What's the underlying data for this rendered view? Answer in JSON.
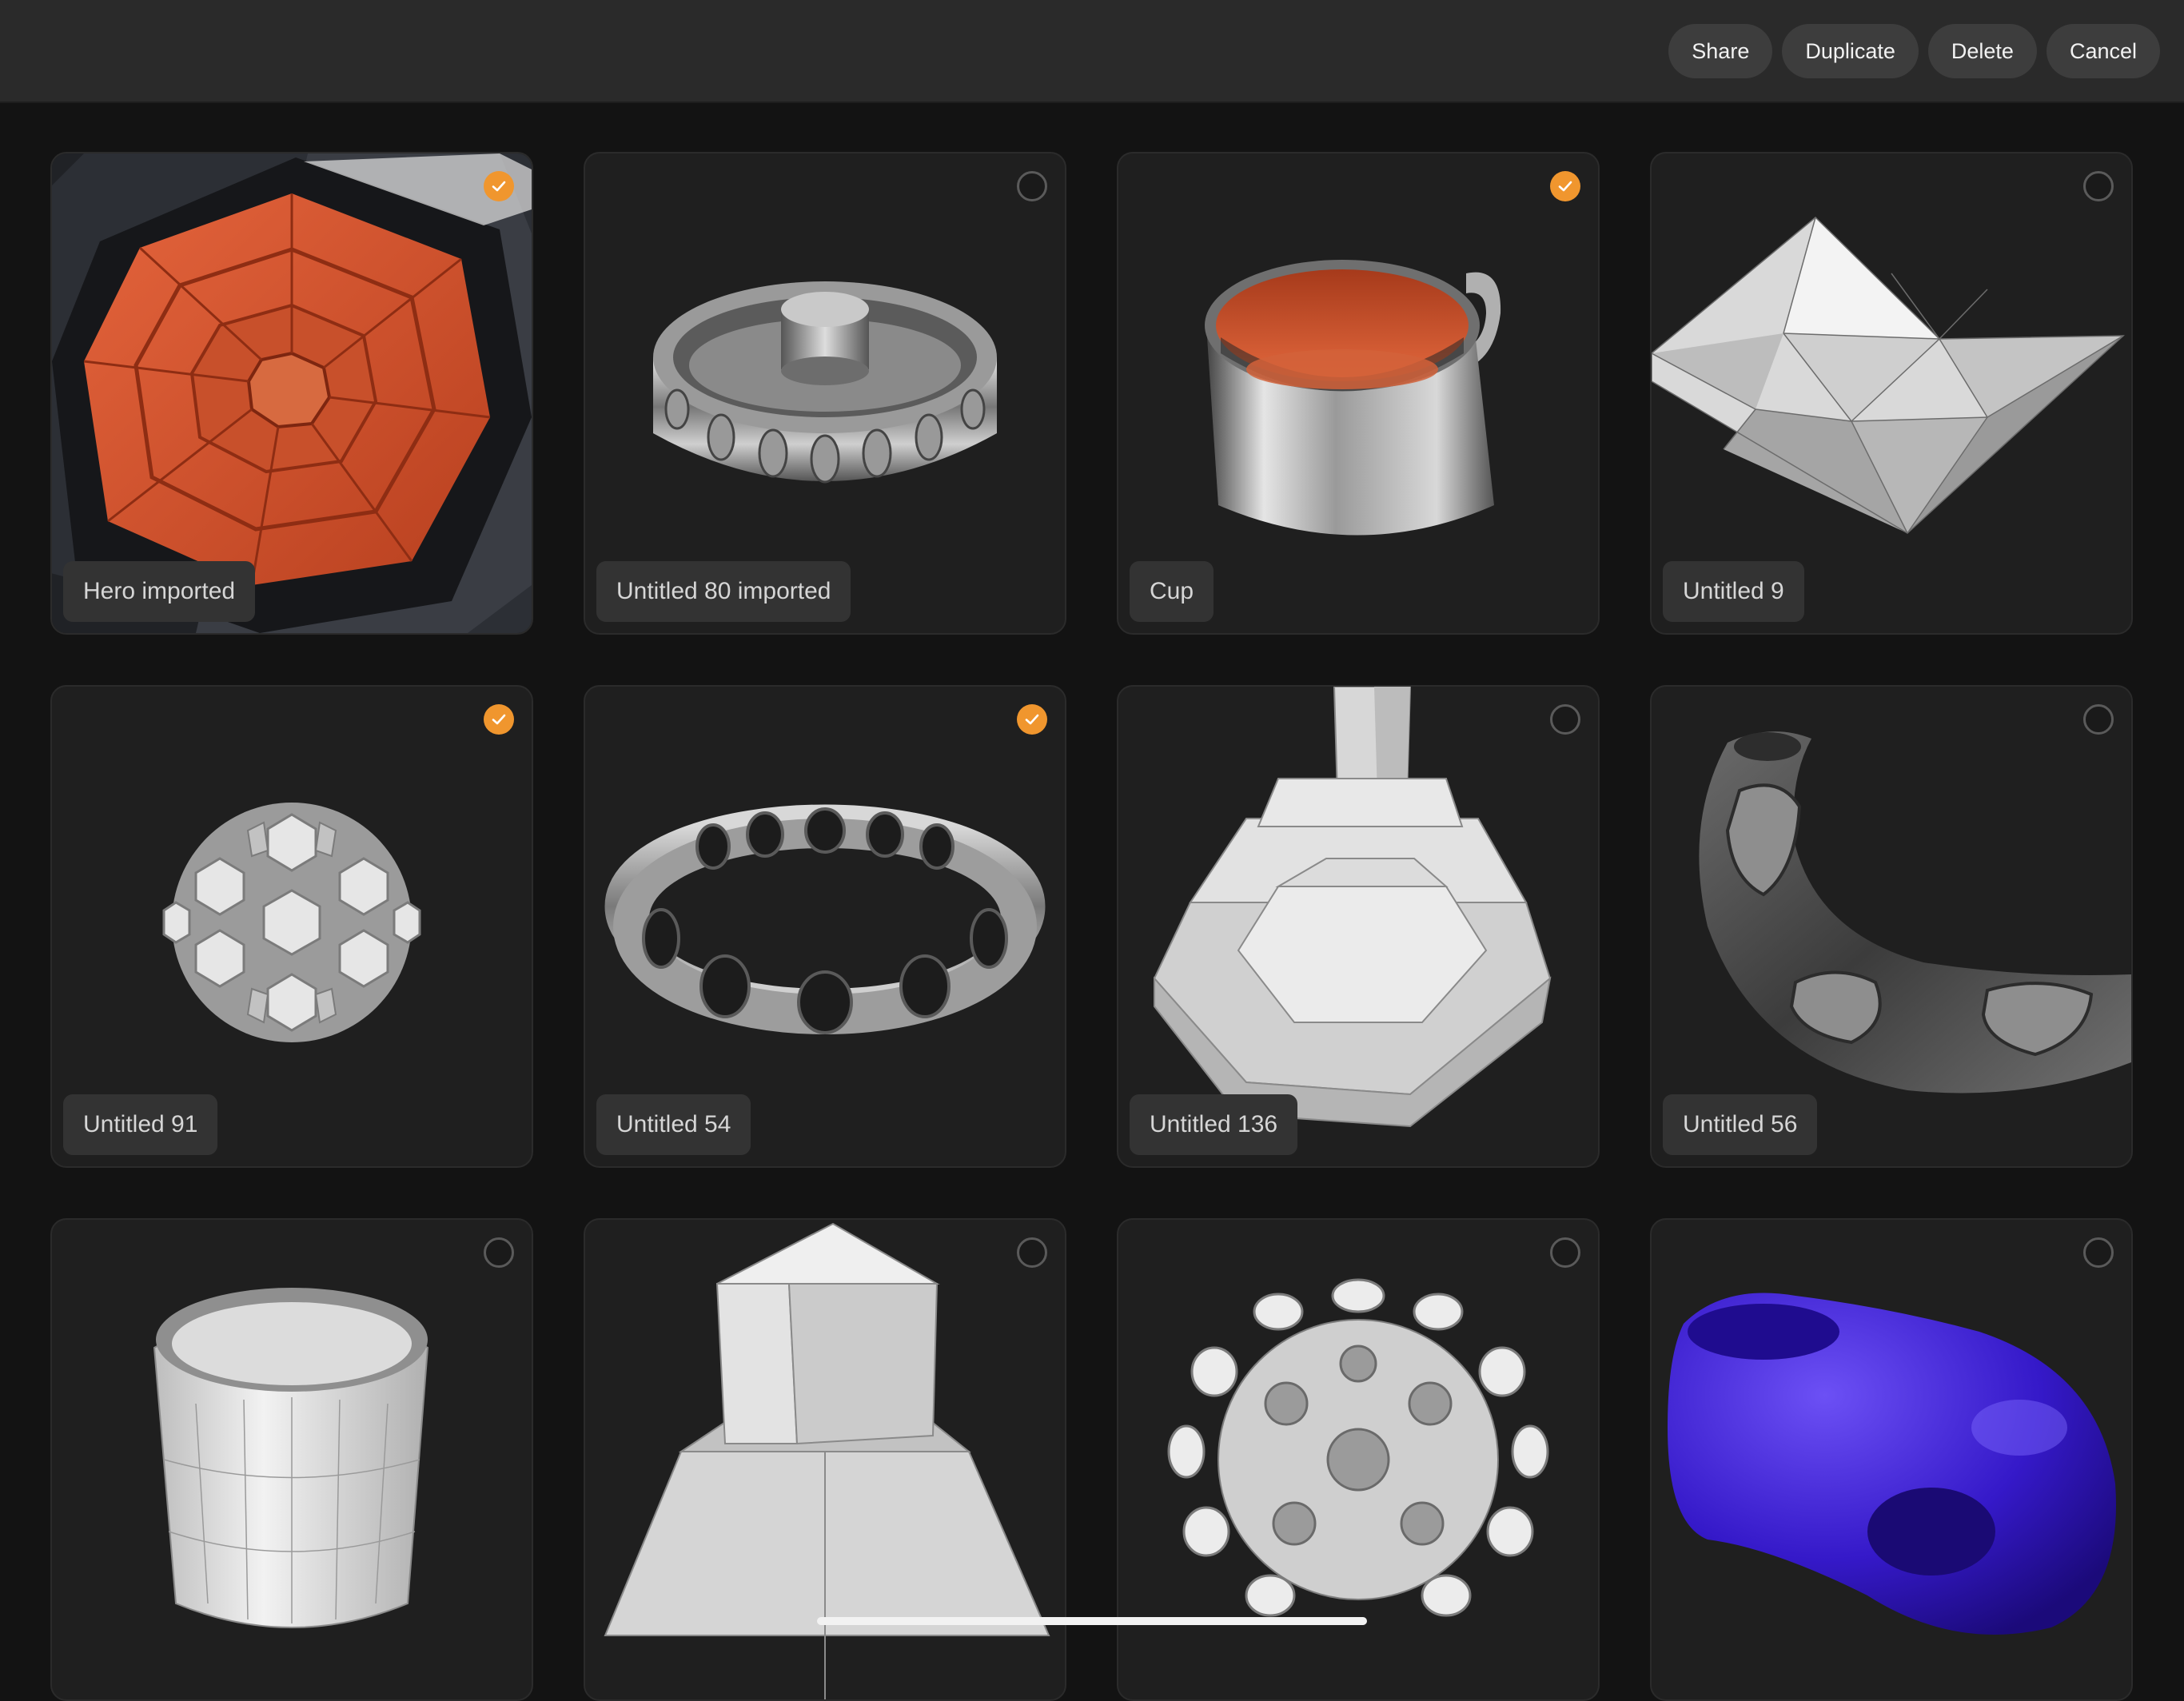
{
  "toolbar": {
    "share": "Share",
    "duplicate": "Duplicate",
    "delete": "Delete",
    "cancel": "Cancel"
  },
  "colors": {
    "accent_selected": "#f0962e",
    "background": "#131313",
    "topbar": "#2a2a2a"
  },
  "projects": [
    {
      "name": "Hero imported",
      "selected": true,
      "thumbnail": "orange-octagon-model"
    },
    {
      "name": "Untitled 80 imported",
      "selected": false,
      "thumbnail": "chrome-ring-model"
    },
    {
      "name": "Cup",
      "selected": true,
      "thumbnail": "chrome-cup-model"
    },
    {
      "name": "Untitled 9",
      "selected": false,
      "thumbnail": "low-poly-terrain-model"
    },
    {
      "name": "Untitled 91",
      "selected": true,
      "thumbnail": "polyhedron-sphere-model"
    },
    {
      "name": "Untitled 54",
      "selected": true,
      "thumbnail": "chrome-bangle-model"
    },
    {
      "name": "Untitled 136",
      "selected": false,
      "thumbnail": "pedestal-model"
    },
    {
      "name": "Untitled 56",
      "selected": false,
      "thumbnail": "dark-crescent-model"
    },
    {
      "name": "",
      "selected": false,
      "thumbnail": "white-cup-model"
    },
    {
      "name": "",
      "selected": false,
      "thumbnail": "pillar-base-model"
    },
    {
      "name": "",
      "selected": false,
      "thumbnail": "spiked-sphere-model"
    },
    {
      "name": "",
      "selected": false,
      "thumbnail": "blue-blob-model"
    }
  ]
}
